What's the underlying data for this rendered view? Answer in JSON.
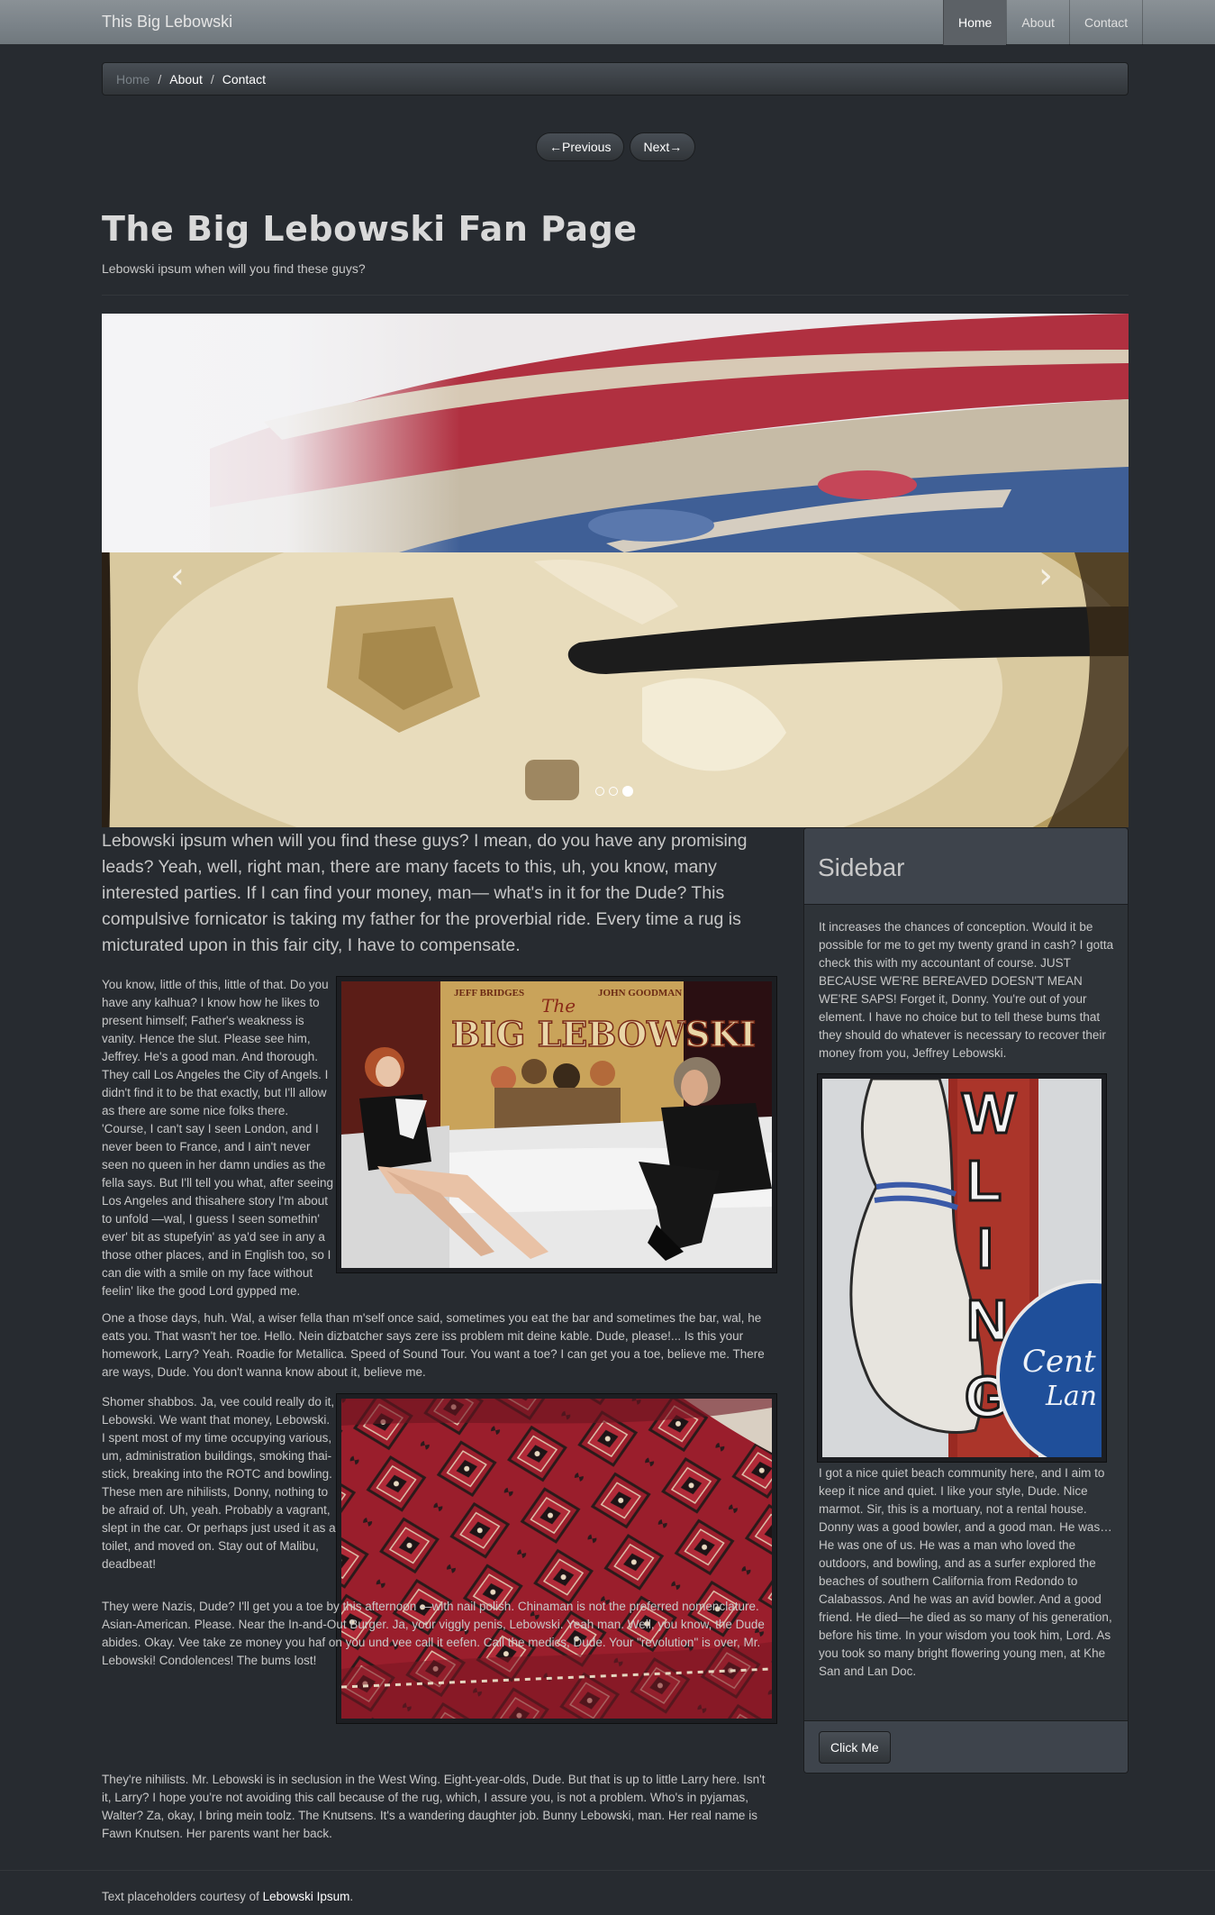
{
  "navbar": {
    "brand": "This Big Lebowski",
    "items": [
      {
        "label": "Home",
        "active": true
      },
      {
        "label": "About",
        "active": false
      },
      {
        "label": "Contact",
        "active": false
      }
    ]
  },
  "breadcrumb": {
    "items": [
      "Home",
      "About",
      "Contact"
    ],
    "separator": "/"
  },
  "pager": {
    "previous": "←Previous",
    "next": "Next→"
  },
  "header": {
    "title": "The Big Lebowski Fan Page",
    "subtitle": "Lebowski ipsum when will you find these guys?"
  },
  "carousel": {
    "prev_icon": "chevron-left-icon",
    "next_icon": "chevron-right-icon",
    "prev_glyph": "‹",
    "next_glyph": "›",
    "slide_count": 3,
    "active_index": 2
  },
  "main": {
    "lead": "Lebowski ipsum when will you find these guys? I mean, do you have any promising leads? Yeah, well, right man, there are many facets to this, uh, you know, many interested parties. If I can find your money, man— what's in it for the Dude? This compulsive fornicator is taking my father for the proverbial ride. Every time a rug is micturated upon in this fair city, I have to compensate.",
    "p1": "You know, little of this, little of that. Do you have any kalhua? I know how he likes to present himself; Father's weakness is vanity. Hence the slut. Please see him, Jeffrey. He's a good man. And thorough. They call Los Angeles the City of Angels. I didn't find it to be that exactly, but I'll allow as there are some nice folks there. 'Course, I can't say I seen London, and I never been to France, and I ain't never seen no queen in her damn undies as the fella says. But I'll tell you what, after seeing Los Angeles and thisahere story I'm about to unfold —wal, I guess I seen somethin' ever' bit as stupefyin' as ya'd see in any a those other places, and in English too, so I can die with a smile on my face without feelin' like the good Lord gypped me.",
    "p2": "One a those days, huh. Wal, a wiser fella than m'self once said, sometimes you eat the bar and sometimes the bar, wal, he eats you. That wasn't her toe. Hello. Nein dizbatcher says zere iss problem mit deine kable. Dude, please!... Is this your homework, Larry? Yeah. Roadie for Metallica. Speed of Sound Tour. You want a toe? I can get you a toe, believe me. There are ways, Dude. You don't wanna know about it, believe me.",
    "p3": "Shomer shabbos. Ja, vee could really do it, Lebowski. We want that money, Lebowski. I spent most of my time occupying various, um, administration buildings, smoking thai-stick, breaking into the ROTC and bowling. These men are nihilists, Donny, nothing to be afraid of. Uh, yeah. Probably a vagrant, slept in the car. Or perhaps just used it as a toilet, and moved on. Stay out of Malibu, deadbeat!",
    "p4": "They were Nazis, Dude? I'll get you a toe by this afternoon —with nail polish. Chinaman is not the preferred nomenclature. Asian-American. Please. Near the In-and-Out Burger. Ja, your viggly penis, Lebowski. Yeah man. Well, you know, the Dude abides. Okay. Vee take ze money you haf on you und vee call it eefen. Call the medics, Dude. Your \"revolution\" is over, Mr. Lebowski! Condolences! The bums lost!",
    "p5": "They're nihilists. Mr. Lebowski is in seclusion in the West Wing. Eight-year-olds, Dude. But that is up to little Larry here. Isn't it, Larry? I hope you're not avoiding this call because of the rug, which, I assure you, is not a problem. Who's in pyjamas, Walter? Za, okay, I bring mein toolz. The Knutsens. It's a wandering daughter job. Bunny Lebowski, man. Her real name is Fawn Knutsen. Her parents want her back.",
    "poster": {
      "top_left": "JEFF BRIDGES",
      "top_right": "JOHN GOODMAN",
      "script": "The",
      "title": "BIG LEBOWSKI"
    }
  },
  "sidebar": {
    "title": "Sidebar",
    "text1": "It increases the chances of conception. Would it be possible for me to get my twenty grand in cash? I gotta check this with my accountant of course. JUST BECAUSE WE'RE BEREAVED DOESN'T MEAN WE'RE SAPS! Forget it, Donny. You're out of your element. I have no choice but to tell these bums that they should do whatever is necessary to recover their money from you, Jeffrey Lebowski.",
    "text2": "I got a nice quiet beach community here, and I aim to keep it nice and quiet. I like your style, Dude. Nice marmot. Sir, this is a mortuary, not a rental house. Donny was a good bowler, and a good man. He was… He was one of us. He was a man who loved the outdoors, and bowling, and as a surfer explored the beaches of southern California from Redondo to Calabassos. And he was an avid bowler. And a good friend. He died—he died as so many of his generation, before his time. In your wisdom you took him, Lord. As you took so many bright flowering young men, at Khe San and Lan Doc.",
    "sign_letters": [
      "W",
      "L",
      "I",
      "N",
      "G"
    ],
    "sign_blue": "Cent",
    "sign_blue2": "Lan",
    "button": "Click Me"
  },
  "footer": {
    "prefix": "Text placeholders courtesy of ",
    "link": "Lebowski Ipsum",
    "suffix": "."
  },
  "colors": {
    "background": "#272b30",
    "navbar": "#7a8288",
    "panel": "#2e3338",
    "panel_head": "#3e444c",
    "text": "#c8c8c8"
  }
}
